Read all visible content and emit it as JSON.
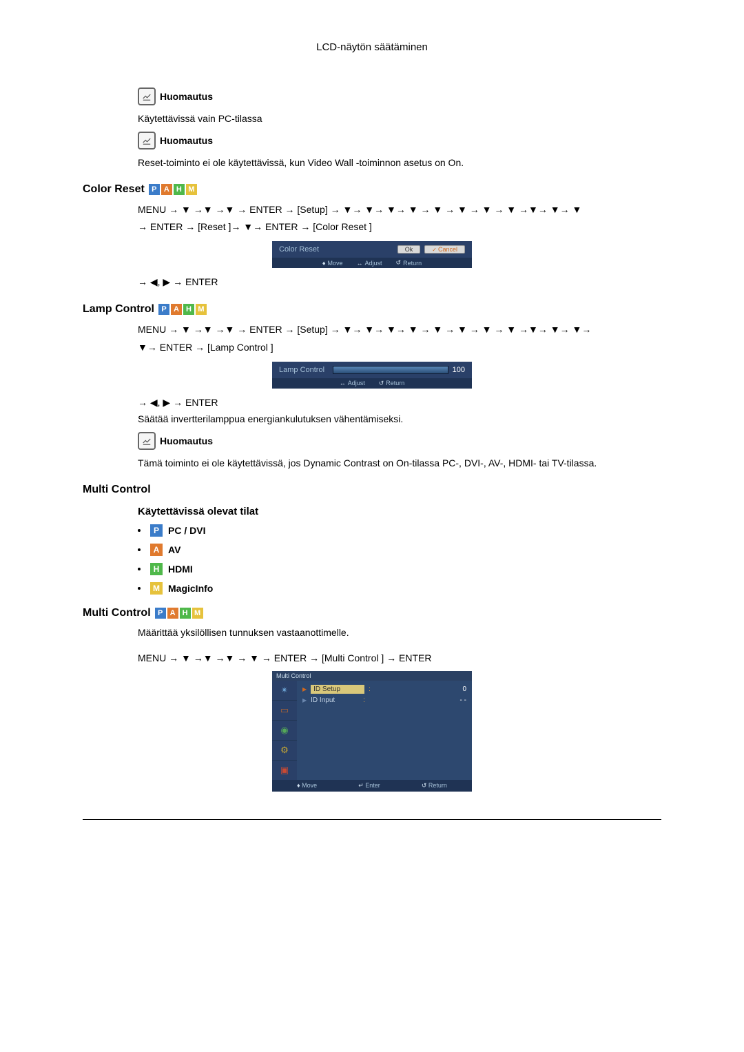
{
  "header": {
    "title": "LCD-näytön säätäminen"
  },
  "notes": {
    "label": "Huomautus",
    "text_pc_only": "Käytettävissä vain PC-tilassa",
    "text_reset": "Reset-toiminto ei ole käytettävissä, kun Video Wall -toiminnon asetus on On."
  },
  "color_reset": {
    "heading": "Color Reset",
    "nav1": "MENU → ▼ →▼ →▼ → ENTER → [Setup] → ▼→ ▼→ ▼→ ▼ → ▼ → ▼ → ▼ → ▼ →▼→ ▼→ ▼",
    "nav2": "→ ENTER → [Reset ]→ ▼→ ENTER → [Color Reset ]",
    "nav3": "→ ◀, ▶ → ENTER",
    "osd": {
      "title": "Color Reset",
      "ok": "Ok",
      "cancel": "Cancel",
      "move": "Move",
      "adjust": "Adjust",
      "ret": "Return"
    }
  },
  "lamp_control": {
    "heading": "Lamp Control",
    "nav1": "MENU → ▼ →▼ →▼ → ENTER → [Setup] → ▼→ ▼→ ▼→ ▼ → ▼ → ▼ → ▼ → ▼ →▼→ ▼→ ▼→",
    "nav2": "▼→ ENTER → [Lamp Control ]",
    "nav3": "→ ◀, ▶ → ENTER",
    "osd": {
      "title": "Lamp Control",
      "value": "100",
      "adjust": "Adjust",
      "ret": "Return"
    },
    "desc": "Säätää invertterilamppua energiankulutuksen vähentämiseksi.",
    "note_text": "Tämä toiminto ei ole käytettävissä, jos Dynamic Contrast on On-tilassa PC-, DVI-, AV-, HDMI- tai TV-tilassa."
  },
  "multi_control": {
    "heading": "Multi Control",
    "subheading": "Käytettävissä olevat tilat",
    "modes": {
      "pc": "PC / DVI",
      "av": "AV",
      "hdmi": "HDMI",
      "magicinfo": "MagicInfo"
    },
    "heading2": "Multi Control",
    "desc": "Määrittää yksilöllisen tunnuksen vastaanottimelle.",
    "nav": "MENU → ▼ →▼ →▼ → ▼ → ENTER → [Multi Control ] → ENTER",
    "osd": {
      "title": "Multi Control",
      "id_setup": "ID  Setup",
      "id_input": "ID  Input",
      "id_setup_val": "0",
      "id_input_val": "- -",
      "move": "Move",
      "enter": "Enter",
      "ret": "Return"
    }
  }
}
